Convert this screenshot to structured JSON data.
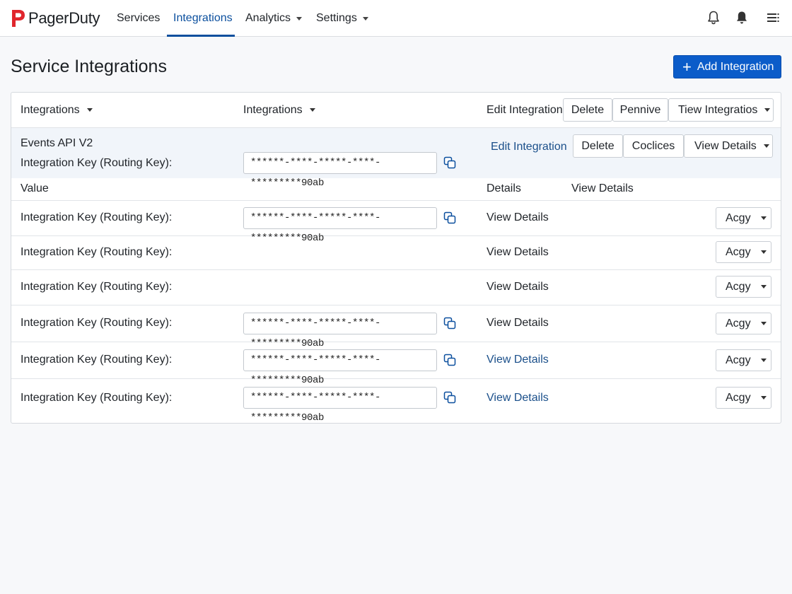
{
  "app": {
    "brand": "PagerDuty",
    "brand_color": "#e0262d",
    "accent_color": "#0b5cc9"
  },
  "nav": {
    "services": "Services",
    "integrations": "Integrations",
    "analytics": "Analytics",
    "settings": "Settings",
    "active": "Integrations"
  },
  "page": {
    "title": "Service Integrations",
    "add_button": "Add Integration"
  },
  "filters": {
    "col1": "Integrations",
    "col2": "Integrations",
    "edit_label": "Edit Integration",
    "delete": "Delete",
    "btn3": "Pennive",
    "btn4": "Tiew Integratios"
  },
  "featured": {
    "name": "Events API V2",
    "key_label": "Integration Key (Routing Key):",
    "key_value": "******-****-*****-****-*********90ab",
    "edit_link": "Edit Integration",
    "delete": "Delete",
    "btn3": "Coclices",
    "btn4": "View Details"
  },
  "columns": {
    "value": "Value",
    "details": "Details",
    "view_details": "View Details"
  },
  "rows": [
    {
      "label": "Integration Key (Routing Key):",
      "key": "******-****-*****-****-*********90ab",
      "details": "View Details",
      "action": "Acgy"
    },
    {
      "label": "Integration Key (Routing Key):",
      "key": "",
      "details": "View Details",
      "action": "Acgy"
    },
    {
      "label": "Integration Key (Routing Key):",
      "key": "",
      "details": "View Details",
      "action": "Acgy"
    },
    {
      "label": "Integration Key (Routing Key):",
      "key": "******-****-*****-****-*********90ab",
      "details": "View Details",
      "action": "Acgy"
    },
    {
      "label": "Integration Key (Routing Key):",
      "key": "******-****-*****-****-*********90ab",
      "details": "View Details",
      "action": "Acgy"
    },
    {
      "label": "Integration Key (Routing Key):",
      "key": "******-****-*****-****-*********90ab",
      "details": "View Details",
      "action": "Acgy"
    }
  ]
}
